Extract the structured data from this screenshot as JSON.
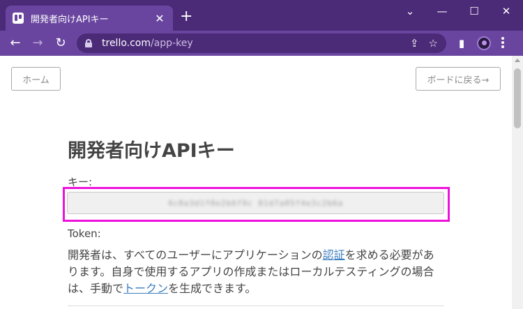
{
  "browser": {
    "tab": {
      "title": "開発者向けAPIキー",
      "close_glyph": "✕"
    },
    "new_tab_glyph": "+",
    "window_controls": {
      "tabsearch": "⌄",
      "minimize": "—",
      "maximize": "☐",
      "close": "✕"
    },
    "nav": {
      "back": "←",
      "forward": "→",
      "reload": "↻"
    },
    "address": {
      "host": "trello.com",
      "path": "/app-key"
    },
    "icons": {
      "share": "⇪",
      "bookmark": "☆",
      "sidepanel": "▮"
    }
  },
  "page": {
    "home_button": "ホーム",
    "back_to_board_button": "ボードに戻る→",
    "title": "開発者向けAPIキー",
    "key_label": "キー:",
    "key_value": "4c8a3d1f0e2b6f9c 81d7a05f4e3c2b6a",
    "token_label": "Token:",
    "description": {
      "part1": "開発者は、すべてのユーザーにアプリケーションの",
      "link1": "認証",
      "part2": "を求める必要があります。自身で使用するアプリの作成またはローカルテスティングの場合は、手動で",
      "link2": "トークン",
      "part3": "を生成できます。"
    }
  },
  "colors": {
    "highlight": "#ee11dd",
    "link": "#3b7bbf",
    "browser_frame": "#6a45a0"
  }
}
